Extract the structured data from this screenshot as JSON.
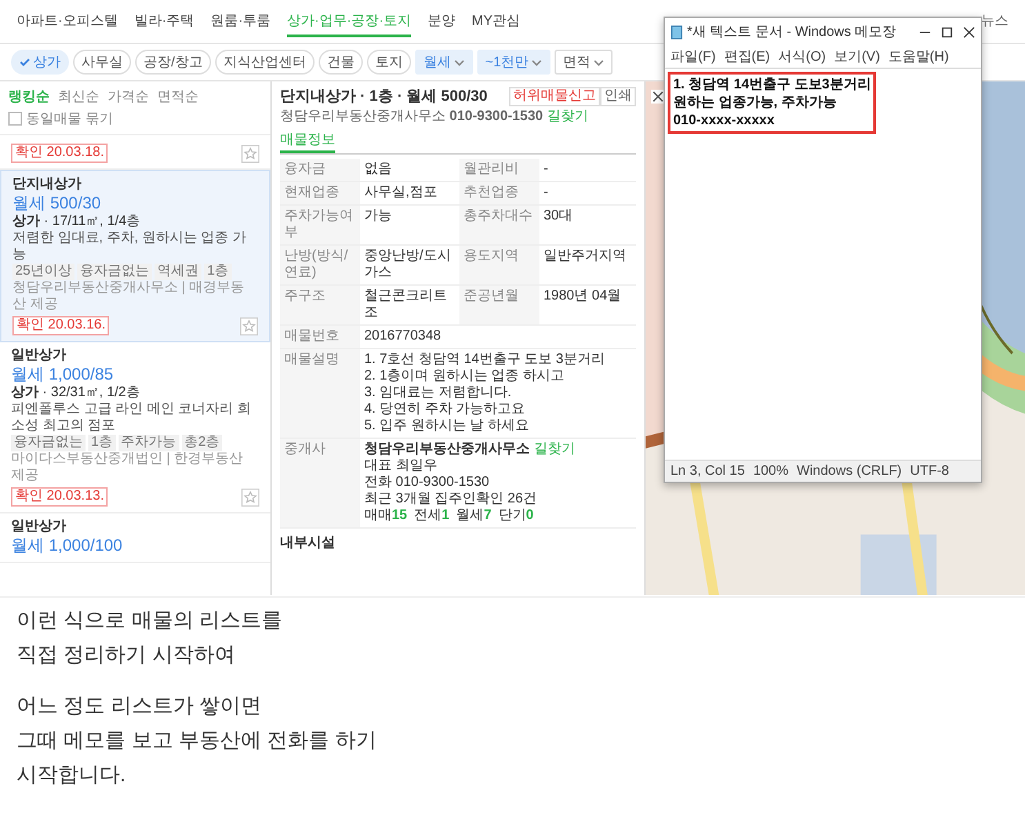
{
  "nav": [
    {
      "label": "아파트·오피스텔",
      "selected": false
    },
    {
      "label": "빌라·주택",
      "selected": false
    },
    {
      "label": "원룸·투룸",
      "selected": false
    },
    {
      "label": "상가·업무·공장·토지",
      "selected": true
    },
    {
      "label": "분양",
      "selected": false
    },
    {
      "label": "MY관심",
      "selected": false
    }
  ],
  "nav_right": "뉴스",
  "filters": [
    {
      "kind": "chip",
      "label": "상가",
      "selected": true
    },
    {
      "kind": "chip",
      "label": "사무실",
      "selected": false
    },
    {
      "kind": "chip",
      "label": "공장/창고",
      "selected": false
    },
    {
      "kind": "chip",
      "label": "지식산업센터",
      "selected": false
    },
    {
      "kind": "chip",
      "label": "건물",
      "selected": false
    },
    {
      "kind": "chip",
      "label": "토지",
      "selected": false
    },
    {
      "kind": "dropdown",
      "label": "월세",
      "selected": true
    },
    {
      "kind": "dropdown",
      "label": "~1천만",
      "selected": true
    },
    {
      "kind": "dropdown",
      "label": "면적",
      "selected": false
    }
  ],
  "sort": [
    {
      "label": "랭킹순",
      "selected": true
    },
    {
      "label": "최신순",
      "selected": false
    },
    {
      "label": "가격순",
      "selected": false
    },
    {
      "label": "면적순",
      "selected": false
    }
  ],
  "group_toggle": {
    "label": "동일매물 묶기",
    "checked": false
  },
  "listings": [
    {
      "confirmed": "확인 20.03.18.",
      "highlighted": false
    },
    {
      "type": "단지내상가",
      "price": "월세 500/30",
      "spec_kind": "상가",
      "spec": " · 17/11㎡, 1/4층",
      "desc": "저렴한 임대료, 주차, 원하시는 업종 가능",
      "tags": [
        "25년이상",
        "융자금없는",
        "역세권",
        "1층"
      ],
      "agency": "청담우리부동산중개사무소 | 매경부동산 제공",
      "confirmed": "확인 20.03.16.",
      "highlighted": true
    },
    {
      "type": "일반상가",
      "price": "월세 1,000/85",
      "spec_kind": "상가",
      "spec": " · 32/31㎡, 1/2층",
      "desc": "피엔폴루스 고급 라인 메인 코너자리 희소성 최고의 점포",
      "tags": [
        "융자금없는",
        "1층",
        "주차가능",
        "총2층"
      ],
      "agency": "마이다스부동산중개법인 | 한경부동산 제공",
      "confirmed": "확인 20.03.13.",
      "highlighted": false
    },
    {
      "type": "일반상가",
      "price": "월세 1,000/100",
      "highlighted": false
    }
  ],
  "detail": {
    "title": "단지내상가 · 1층 · 월세 500/30",
    "agency": "청담우리부동산중개사무소",
    "phone": "010-9300-1530",
    "directions": "길찾기",
    "report": "허위매물신고",
    "print": "인쇄",
    "tab": "매물정보",
    "rows": [
      {
        "label": "융자금",
        "value": "없음",
        "label2": "월관리비",
        "value2": "-"
      },
      {
        "label": "현재업종",
        "value": "사무실,점포",
        "label2": "추천업종",
        "value2": "-"
      },
      {
        "label": "주차가능여부",
        "value": "가능",
        "label2": "총주차대수",
        "value2": "30대"
      },
      {
        "label": "난방(방식/연료)",
        "value": "중앙난방/도시가스",
        "label2": "용도지역",
        "value2": "일반주거지역"
      },
      {
        "label": "주구조",
        "value": "철근콘크리트조",
        "label2": "준공년월",
        "value2": "1980년 04월"
      }
    ],
    "number_label": "매물번호",
    "number": "2016770348",
    "desc_label": "매물설명",
    "desc_lines": [
      "1. 7호선 청담역 14번출구 도보 3분거리",
      "2. 1층이며 원하시는 업종 하시고",
      "3. 임대료는 저렴합니다.",
      "4. 당연히 주차 가능하고요",
      "5. 입주 원하시는 날 하세요"
    ],
    "broker_label": "중개사",
    "broker_name": "청담우리부동산중개사무소",
    "broker_link": "길찾기",
    "broker_lines": [
      "대표 최일우",
      "전화 010-9300-1530",
      "최근 3개월 집주인확인 26건"
    ],
    "counts": [
      {
        "label": "매매",
        "value": "15"
      },
      {
        "label": "전세",
        "value": "1"
      },
      {
        "label": "월세",
        "value": "7"
      },
      {
        "label": "단기",
        "value": "0"
      }
    ],
    "facilities": "내부시설"
  },
  "notepad": {
    "title": "*새 텍스트 문서 - Windows 메모장",
    "menu": [
      "파일(F)",
      "편집(E)",
      "서식(O)",
      "보기(V)",
      "도움말(H)"
    ],
    "lines": [
      "1. 청담역 14번출구 도보3분거리",
      "원하는 업종가능, 주차가능",
      "010-xxxx-xxxxx"
    ],
    "status": [
      "Ln 3, Col 15",
      "100%",
      "Windows (CRLF)",
      "UTF-8"
    ]
  },
  "article": [
    [
      "이런 식으로 매물의 리스트를",
      "직접 정리하기 시작하여"
    ],
    [
      "어느 정도 리스트가 쌓이면",
      "그때 메모를 보고 부동산에 전화를 하기",
      "시작합니다."
    ]
  ]
}
